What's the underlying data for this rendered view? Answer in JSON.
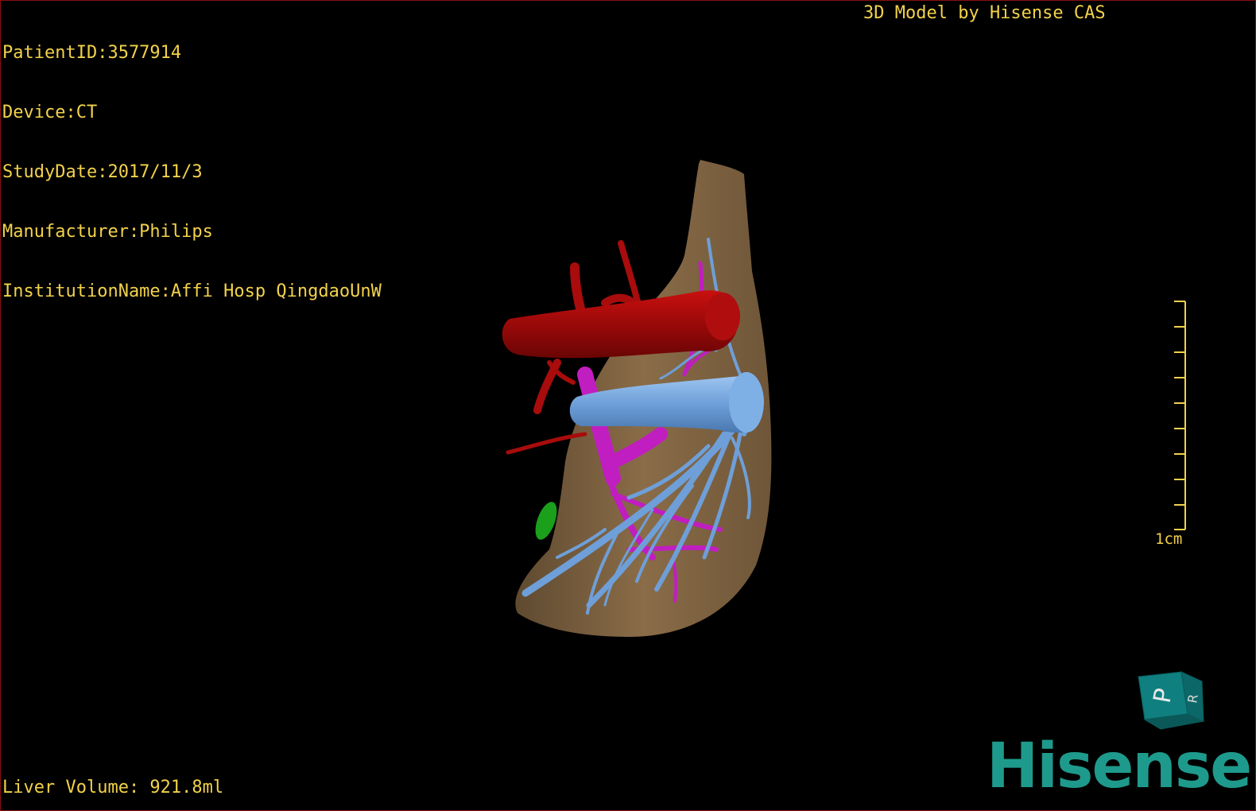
{
  "patient_info": {
    "patient_id": "PatientID:3577914",
    "device": "Device:CT",
    "study_date": "StudyDate:2017/11/3",
    "manufacturer": "Manufacturer:Philips",
    "institution": "InstitutionName:Affi Hosp QingdaoUnW"
  },
  "credit": "3D Model by Hisense CAS",
  "liver_volume": "Liver Volume: 921.8ml",
  "scale_bar": {
    "label": "1cm"
  },
  "orientation_cube": {
    "face_letter": "P",
    "side_letter": "R",
    "color": "#0f7f7f"
  },
  "logo": {
    "text": "Hisense",
    "color": "#1e9a8c"
  },
  "colors": {
    "overlay_text": "#f2d24a",
    "liver": "#7a6040",
    "artery": "#a80c0c",
    "portal_vein": "#c01ec0",
    "hepatic_vein": "#6e9fd8",
    "gallbladder_lesion": "#1aa01a",
    "border": "#8a1010"
  }
}
